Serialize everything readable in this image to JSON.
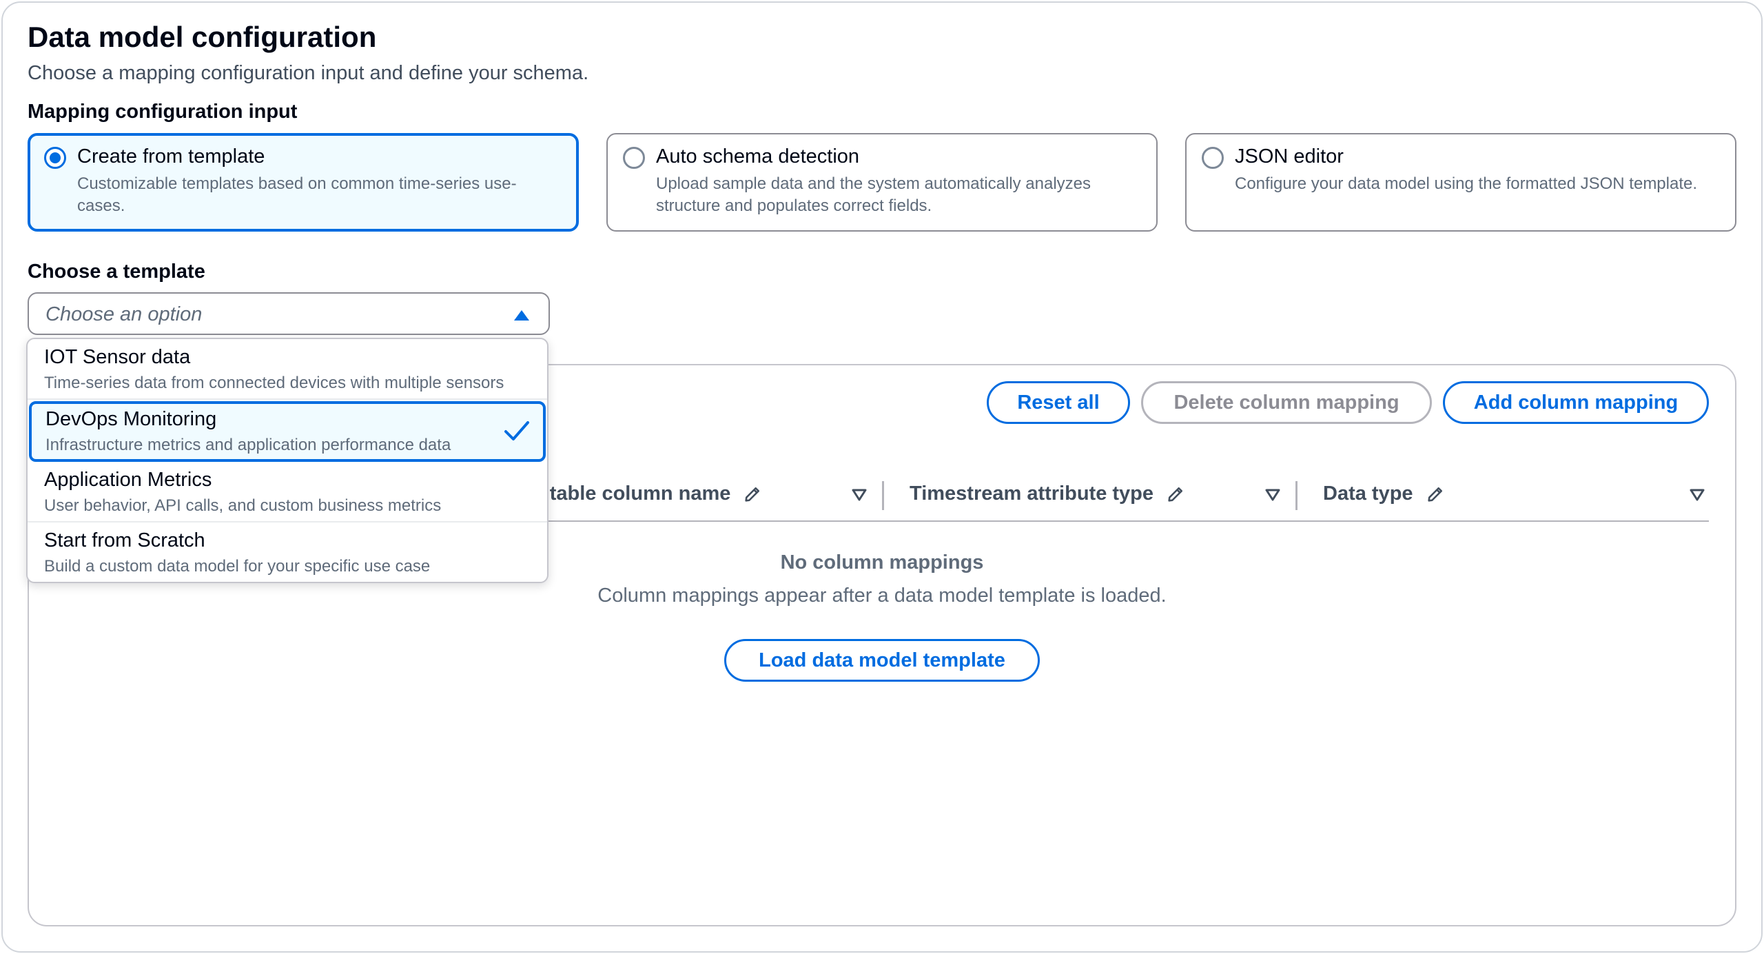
{
  "page": {
    "title": "Data model configuration",
    "subtitle": "Choose a mapping configuration input and define your schema."
  },
  "mapping_input": {
    "label": "Mapping configuration input",
    "options": [
      {
        "label": "Create from template",
        "description": "Customizable templates based on common time-series use-cases.",
        "selected": true
      },
      {
        "label": "Auto schema detection",
        "description": "Upload sample data and the system automatically analyzes structure and populates correct fields.",
        "selected": false
      },
      {
        "label": "JSON editor",
        "description": "Configure your data model using the formatted JSON template.",
        "selected": false
      }
    ]
  },
  "template_select": {
    "label": "Choose a template",
    "placeholder": "Choose an option",
    "expanded": true,
    "options": [
      {
        "label": "IOT Sensor data",
        "description": "Time-series data from connected devices with multiple sensors",
        "selected": false
      },
      {
        "label": "DevOps Monitoring",
        "description": "Infrastructure metrics and application performance data",
        "selected": true
      },
      {
        "label": "Application Metrics",
        "description": "User behavior, API calls, and custom business metrics",
        "selected": false
      },
      {
        "label": "Start from Scratch",
        "description": "Build a custom data model for your specific use case",
        "selected": false
      }
    ]
  },
  "toolbar": {
    "reset_label": "Reset all",
    "delete_label": "Delete column mapping",
    "add_label": "Add column mapping"
  },
  "table": {
    "columns": [
      "t table column name",
      "Timestream attribute type",
      "Data type"
    ],
    "empty_title": "No column mappings",
    "empty_description": "Column mappings appear after a data model template is loaded.",
    "load_label": "Load data model template"
  },
  "colors": {
    "accent": "#006ce0",
    "selected_bg": "#f0fbff",
    "border": "#8c8c94",
    "text_primary": "#000716",
    "text_secondary": "#5f6b7a"
  }
}
